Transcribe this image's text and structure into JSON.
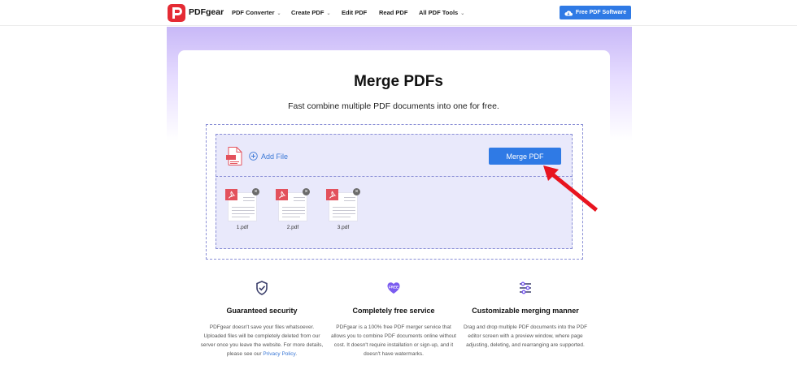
{
  "header": {
    "brand": "PDFgear",
    "nav": [
      {
        "label": "PDF Converter",
        "dropdown": true
      },
      {
        "label": "Create PDF",
        "dropdown": true
      },
      {
        "label": "Edit PDF",
        "dropdown": false
      },
      {
        "label": "Read PDF",
        "dropdown": false
      },
      {
        "label": "All PDF Tools",
        "dropdown": true
      }
    ],
    "cta": "Free PDF Software"
  },
  "main": {
    "title": "Merge PDFs",
    "subtitle": "Fast combine multiple PDF documents into one for free.",
    "add_file": "Add File",
    "merge_button": "Merge PDF",
    "files": [
      {
        "name": "1.pdf"
      },
      {
        "name": "2.pdf"
      },
      {
        "name": "3.pdf"
      }
    ]
  },
  "features": [
    {
      "icon": "shield-check-icon",
      "title": "Guaranteed security",
      "desc": "PDFgear doesn't save your files whatsoever. Uploaded files will be completely deleted from our server once you leave the website. For more details, please see our",
      "link": "Privacy Policy",
      "after": "."
    },
    {
      "icon": "heart-free-icon",
      "title": "Completely free service",
      "desc": "PDFgear is a 100% free PDF merger service that allows you to combine PDF documents online without cost. It doesn't require installation or sign-up, and it doesn't have watermarks."
    },
    {
      "icon": "sliders-icon",
      "title": "Customizable merging manner",
      "desc": "Drag and drop multiple PDF documents into the PDF editor screen with a preview window, where page adjusting, deleting, and rearranging are supported."
    }
  ],
  "colors": {
    "brand_red": "#e52b34",
    "primary_blue": "#2f7ae5",
    "hero_purple": "#c8b8f7",
    "arrow_red": "#e8141f"
  }
}
